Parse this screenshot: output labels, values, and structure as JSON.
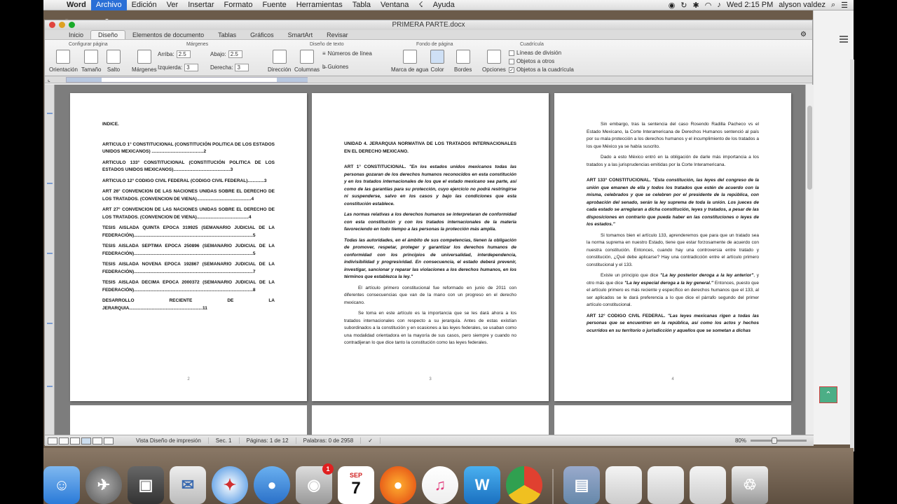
{
  "menubar": {
    "app": "Word",
    "items": [
      "Archivo",
      "Edición",
      "Ver",
      "Insertar",
      "Formato",
      "Fuente",
      "Herramientas",
      "Tabla",
      "Ventana"
    ],
    "help": "Ayuda",
    "clock": "Wed 2:15 PM",
    "user": "alyson valdez"
  },
  "window": {
    "title": "PRIMERA PARTE.docx",
    "tabs": [
      "Inicio",
      "Diseño",
      "Elementos de documento",
      "Tablas",
      "Gráficos",
      "SmartArt",
      "Revisar"
    ]
  },
  "ribbon": {
    "groups": {
      "configurar": "Configurar página",
      "margenes": "Márgenes",
      "diseno_texto": "Diseño de texto",
      "fondo": "Fondo de página",
      "cuadricula": "Cuadrícula"
    },
    "buttons": {
      "orientacion": "Orientación",
      "tamano": "Tamaño",
      "salto": "Salto",
      "margenes": "Márgenes",
      "direccion": "Dirección",
      "columnas": "Columnas",
      "marca_agua": "Marca de agua",
      "color": "Color",
      "bordes": "Bordes",
      "opciones": "Opciones",
      "numeros_linea": "Números de línea",
      "guiones": "Guiones"
    },
    "fields": {
      "arriba_label": "Arriba:",
      "arriba": "2.5",
      "abajo_label": "Abajo:",
      "abajo": "2.5",
      "izquierda_label": "Izquierda:",
      "izquierda": "3",
      "derecha_label": "Derecha:",
      "derecha": "3"
    },
    "checks": {
      "lineas_division": "Líneas de división",
      "objetos_otros": "Objetos a otros",
      "objetos_cuadricula": "Objetos a la cuadrícula"
    }
  },
  "pages": {
    "p1": {
      "heading": "INDICE.",
      "entries": [
        "ARTICULO 1° CONSTITUCIONAL (CONSTITUCIÓN POLITICA DE LOS ESTADOS UNIDOS MEXICANOS) .........................................2",
        "ARTICULO 133° CONSTITUCIONAL (CONSTITUCIÓN POLITICA DE LOS ESTADOS UNIDOS MEXICANOS).............................................3",
        "ARTICULO 12° CODIGO CIVIL FEDERAL (CODIGO CIVIL FEDERAL).............3",
        "ART 26° CONVENCION DE LAS NACIONES UNIDAS SOBRE EL DERECHO DE LOS TRATADOS. (CONVENCION DE VIENA)...........................................4",
        "ART 27° CONVENCION DE LAS NACIONES UNIDAS SOBRE EL DERECHO DE LOS TRATADOS. (CONVENCION DE VIENA).........................................4",
        "TESIS AISLADA QUINTA EPOCA 319925 (SEMANARIO JUDICIAL DE LA FEDERACIÓN)..............................................................................................5",
        "TESIS AISLADA SEPTIMA EPOCA 250896 (SEMANARIO JUDICIAL DE LA FEDERACIÓN)..............................................................................................5",
        "TESIS AISLADA NOVENA EPOCA 192867 (SEMANARIO JUDICIAL DE LA FEDERACIÓN)..............................................................................................7",
        "TESIS AISLADA DECIMA EPOCA 2000372 (SEMANARIO JUDICIAL DE LA FEDERACIÓN)..............................................................................................8",
        "DESARROLLO RECIENTE DE LA JERARQUIA..........................................................11"
      ],
      "number": "2"
    },
    "p2": {
      "heading": "UNIDAD 4. JERARQUIA NORMATIVA DE LOS TRATADOS INTERNACIONALES EN EL DERECHO MEXICANO.",
      "art1_label": "ART 1° CONSTITUCIONAL.",
      "art1_text": "\"En los estados unidos mexicanos todas las personas gozaran de los derechos humanos reconocidos en esta constitución y en los tratados internacionales de los que el estado mexicano sea parte, así como de las garantías para su protección, cuyo ejercicio no podrá restringirse ni suspenderse, salvo en los casos y bajo las condiciones que esta constitución establece.",
      "para2": "Las normas relativas a los derechos humanos se interpretaran de conformidad con esta constitución y con los tratados internacionales de la materia favoreciendo en todo tiempo a las personas la protección más amplia.",
      "para3": "Todas las autoridades, en el ámbito de sus competencias, tienen la obligación de promover, respetar, proteger y garantizar los derechos humanos de conformidad con los principios de universalidad, interdependencia, indivisibilidad y progresividad. En consecuencia, el estado deberá prevenir, investigar, sancionar y reparar las violaciones a los derechos humanos, en los términos que establezca la ley.\"",
      "para4": "El artículo primero constitucional fue reformado en junio de 2011 con diferentes consecuencias que van de la mano con un progreso en el derecho mexicano.",
      "para5": "Se toma en este artículo es la importancia que se les dará ahora a los tratados internacionales con respecto a su jerarquía. Antes de estas existían subordinados a la constitución y en ocasiones a las leyes federales, se usaban como una modalidad orientadora en la mayoría de sus casos, pero siempre y cuando no contradijeran lo que dice tanto la constitución como las leyes federales.",
      "number": "3"
    },
    "p3": {
      "para1": "Sin embargo, tras la sentencia del caso Rosendo Radilla Pacheco vs el Estado Mexicano, la Corte Interamericana de Derechos Humanos sentenció al país por su mala protección a los derechos humanos y el incumplimiento de los tratados a los que México ya se había suscrito.",
      "para2": "Dado a esto México entró en la obligación de darle más importancia a los tratados y a las jurisprudencias emitidas por la Corte Interamericana.",
      "art133_label": "ART 133° CONSTITUCIONAL.",
      "art133_text": "\"Esta constitución, las leyes del congreso de la unión que emanen de ella y todos los tratados que estén de acuerdo con la misma, celebrados y que se celebren por el presidente de la república, con aprobación del senado, serán la ley suprema de toda la unión. Los jueces de cada estado se arreglaran a dicha constitución, leyes y tratados, a pesar de las disposiciones en contrario que pueda haber en las constituciones o leyes de los estados.\"",
      "para3": "Si tomamos bien el artículo 133, aprenderemos que para que un tratado sea la norma suprema en nuestro Estado, tiene que estar forzosamente de acuerdo con nuestra constitución. Entonces, cuando hay una controversia entre tratado y constitución, ¿Qué debe aplicarse? Hay una contradicción entre el artículo primero constitucional y el 133.",
      "para4a": "Existe un principio que dice",
      "para4b": "\"La ley posterior deroga a la ley anterior\"",
      "para4c": ", y otro más que dice",
      "para4d": "\"La ley especial deroga a la ley general.\"",
      "para4e": " Entonces, puesto que el artículo primero es más reciente y específico en derechos humanos que el 133, al ser aplicados se le dará preferencia a lo que dice el párrafo segundo del primer artículo constitucional.",
      "art12_label": "ART 12° CODIGO CIVIL FEDERAL.",
      "art12_text": "\"Las leyes mexicanas rigen a todas las personas que se encuentren en la república, así como los actos y hechos ocurridos en su territorio o jurisdicción y aquellos que se sometan a dichas",
      "number": "4"
    }
  },
  "statusbar": {
    "view": "Vista Diseño de impresión",
    "sec_label": "Sec.",
    "sec": "1",
    "paginas_label": "Páginas:",
    "paginas": "1 de 12",
    "palabras_label": "Palabras:",
    "palabras": "0 de 2958",
    "zoom": "80%"
  },
  "dock": {
    "calendar_month": "SEP",
    "calendar_day": "7",
    "badge": "1"
  },
  "colors": {
    "menu_active": "#2a6fd6",
    "scroll_top_button": "#4cae86"
  }
}
